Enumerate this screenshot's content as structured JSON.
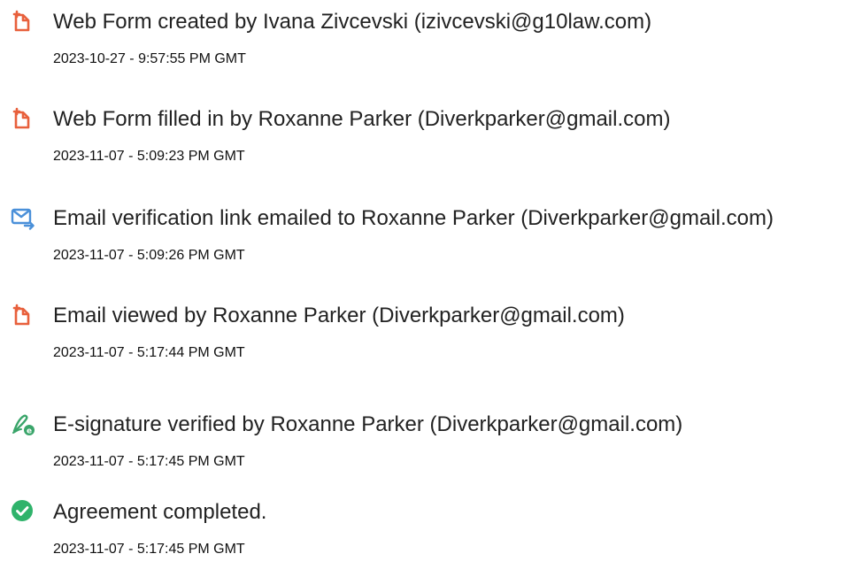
{
  "events": [
    {
      "icon": "document-icon",
      "title": "Web Form created by Ivana Zivcevski (izivcevski@g10law.com)",
      "timestamp": "2023-10-27 - 9:57:55 PM GMT"
    },
    {
      "icon": "document-icon",
      "title": "Web Form filled in by Roxanne Parker (Diverkparker@gmail.com)",
      "timestamp": "2023-11-07 - 5:09:23 PM GMT"
    },
    {
      "icon": "email-send-icon",
      "title": "Email verification link emailed to Roxanne Parker (Diverkparker@gmail.com)",
      "timestamp": "2023-11-07 - 5:09:26 PM GMT"
    },
    {
      "icon": "document-icon",
      "title": "Email viewed by Roxanne Parker (Diverkparker@gmail.com)",
      "timestamp": "2023-11-07 - 5:17:44 PM GMT"
    },
    {
      "icon": "esignature-verified-icon",
      "title": "E-signature verified by Roxanne Parker (Diverkparker@gmail.com)",
      "timestamp": "2023-11-07 - 5:17:45 PM GMT"
    },
    {
      "icon": "checkmark-circle-icon",
      "title": "Agreement completed.",
      "timestamp": "2023-11-07 - 5:17:45 PM GMT"
    }
  ],
  "colors": {
    "document_icon": "#e8603c",
    "email_icon": "#4a90d9",
    "signature_icon": "#3aa56a",
    "check_icon": "#2fb36b",
    "text": "#222222"
  }
}
